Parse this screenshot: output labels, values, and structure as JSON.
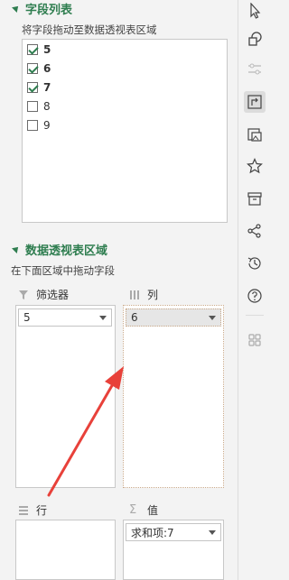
{
  "fields": {
    "title": "字段列表",
    "hint": "将字段拖动至数据透视表区域",
    "items": [
      {
        "label": "5",
        "checked": true
      },
      {
        "label": "6",
        "checked": true
      },
      {
        "label": "7",
        "checked": true
      },
      {
        "label": "8",
        "checked": false
      },
      {
        "label": "9",
        "checked": false
      }
    ]
  },
  "areas": {
    "title": "数据透视表区域",
    "hint": "在下面区域中拖动字段",
    "filter": {
      "label": "筛选器",
      "value": "5"
    },
    "columns": {
      "label": "列",
      "value": "6"
    },
    "rows": {
      "label": "行"
    },
    "values": {
      "label": "值",
      "value": "求和项:7"
    }
  },
  "rail": {
    "icons": [
      "cursor-icon",
      "shapes-icon",
      "adjust-icon",
      "pivot-icon",
      "image-settings-icon",
      "star-icon",
      "archive-icon",
      "share-icon",
      "history-icon",
      "help-icon",
      "grid-icon"
    ]
  },
  "colors": {
    "accent": "#2e7d4f",
    "arrow": "#e8413a"
  }
}
